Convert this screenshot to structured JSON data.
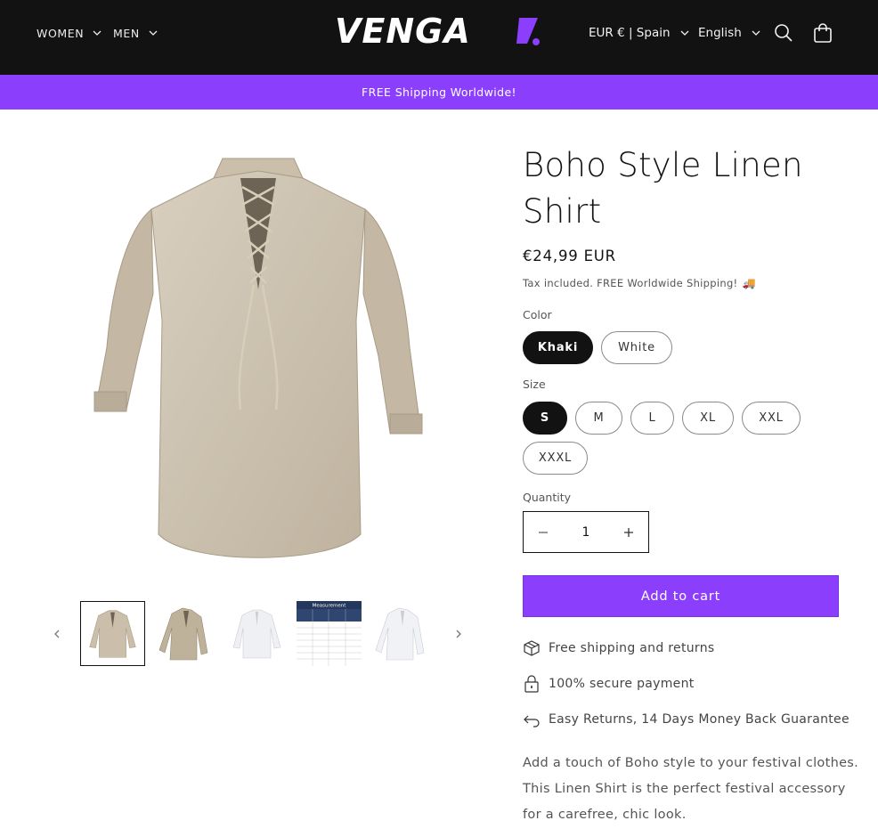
{
  "header": {
    "nav": [
      {
        "label": "WOMEN"
      },
      {
        "label": "MEN"
      }
    ],
    "logo_text": "VENGA!",
    "currency": "EUR € | Spain",
    "language": "English",
    "icons": [
      "search-icon",
      "cart-icon"
    ]
  },
  "announcement": "FREE Shipping Worldwide!",
  "product": {
    "title": "Boho Style Linen Shirt",
    "price": "€24,99 EUR",
    "tax_note": "Tax included. FREE Worldwide Shipping!",
    "tax_emoji": "🚚",
    "color": {
      "label": "Color",
      "options": [
        "Khaki",
        "White"
      ],
      "selected": "Khaki"
    },
    "size": {
      "label": "Size",
      "options": [
        "S",
        "M",
        "L",
        "XL",
        "XXL",
        "XXXL"
      ],
      "selected": "S"
    },
    "quantity": {
      "label": "Quantity",
      "value": "1",
      "minus": "−",
      "plus": "+"
    },
    "add_to_cart": "Add to cart",
    "features": [
      {
        "icon": "box-icon",
        "text": "Free shipping and returns"
      },
      {
        "icon": "lock-icon",
        "text": "100% secure payment"
      },
      {
        "icon": "return-arrow-icon",
        "text": "Easy Returns, 14 Days Money Back Guarantee"
      }
    ],
    "description": "Add a touch of Boho style to your festival clothes. This Linen Shirt is the perfect festival accessory for a carefree, chic look.",
    "thumbnails": [
      {
        "name": "khaki-front",
        "active": true
      },
      {
        "name": "khaki-angle",
        "active": false
      },
      {
        "name": "white-front",
        "active": false
      },
      {
        "name": "size-chart",
        "active": false,
        "text": "Measurement"
      },
      {
        "name": "white-angle",
        "active": false
      }
    ]
  },
  "colors": {
    "header_bg": "#121212",
    "accent": "#8b3ffc",
    "khaki": "#cdc2b0",
    "white_shirt": "#eef0f3"
  }
}
